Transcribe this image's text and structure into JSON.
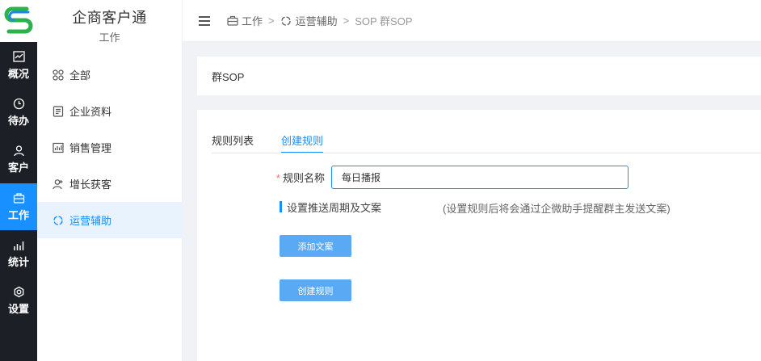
{
  "brand": {
    "title": "企商客户通",
    "subtitle": "工作"
  },
  "rail": {
    "items": [
      {
        "label": "概况",
        "icon": "line-chart-icon"
      },
      {
        "label": "待办",
        "icon": "clock-icon"
      },
      {
        "label": "客户",
        "icon": "user-icon"
      },
      {
        "label": "工作",
        "icon": "briefcase-icon",
        "active": true
      },
      {
        "label": "统计",
        "icon": "bar-chart-icon"
      },
      {
        "label": "设置",
        "icon": "gear-icon"
      }
    ]
  },
  "sidebar": {
    "items": [
      {
        "label": "全部",
        "icon": "grid-icon"
      },
      {
        "label": "企业资料",
        "icon": "document-icon"
      },
      {
        "label": "销售管理",
        "icon": "chart-board-icon"
      },
      {
        "label": "增长获客",
        "icon": "user-add-icon"
      },
      {
        "label": "运营辅助",
        "icon": "shield-icon",
        "active": true
      }
    ]
  },
  "breadcrumb": {
    "items": [
      {
        "label": "工作",
        "icon": "briefcase-icon"
      },
      {
        "label": "运营辅助",
        "icon": "shield-icon"
      },
      {
        "label": "SOP 群SOP"
      }
    ],
    "separator": ">"
  },
  "page": {
    "title": "群SOP"
  },
  "tabs": [
    {
      "label": "规则列表",
      "active": false
    },
    {
      "label": "创建规则",
      "active": true
    }
  ],
  "form": {
    "rule_name_label": "规则名称",
    "required_mark": "*",
    "rule_name_value": "每日播报",
    "section_title": "设置推送周期及文案",
    "section_hint": "(设置规则后将会通过企微助手提醒群主发送文案)",
    "add_copy_button": "添加文案",
    "create_rule_button": "创建规则"
  },
  "colors": {
    "accent": "#1890ff",
    "rail_bg": "#1d1f26",
    "button_bg": "#5aa9f5",
    "required": "#f56c6c"
  }
}
